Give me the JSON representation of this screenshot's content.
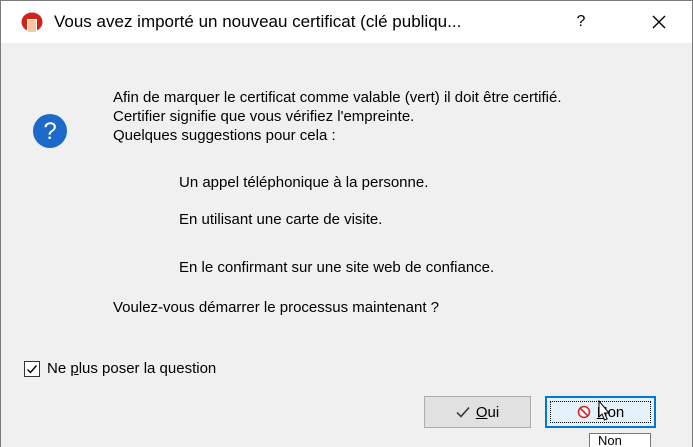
{
  "window": {
    "title": "Vous avez importé un nouveau certificat (clé publiqu...",
    "help_label": "?",
    "close_icon": "close-icon",
    "app_icon": "kleopatra-icon"
  },
  "message": {
    "icon": "question-icon",
    "lines": [
      "Afin de marquer le certificat comme valable (vert) il doit être certifié.",
      "Certifier signifie que vous vérifiez l'empreinte.",
      "Quelques suggestions pour cela :"
    ],
    "suggestions": [
      "Un appel téléphonique à la personne.",
      "En utilisant une carte de visite.",
      "En le confirmant sur une site web de confiance."
    ],
    "prompt": "Voulez-vous démarrer le processus maintenant ?"
  },
  "checkbox": {
    "label_pre": "Ne ",
    "label_mnemonic": "p",
    "label_post": "lus poser la question",
    "checked": true
  },
  "buttons": {
    "yes_mnemonic": "O",
    "yes_rest": "ui",
    "no_mnemonic": "N",
    "no_rest": "on"
  },
  "tooltip": {
    "text": "Non"
  },
  "colors": {
    "question_icon": "#1b6ac9",
    "app_icon": "#d0211c",
    "focus_border": "#0078d7"
  }
}
